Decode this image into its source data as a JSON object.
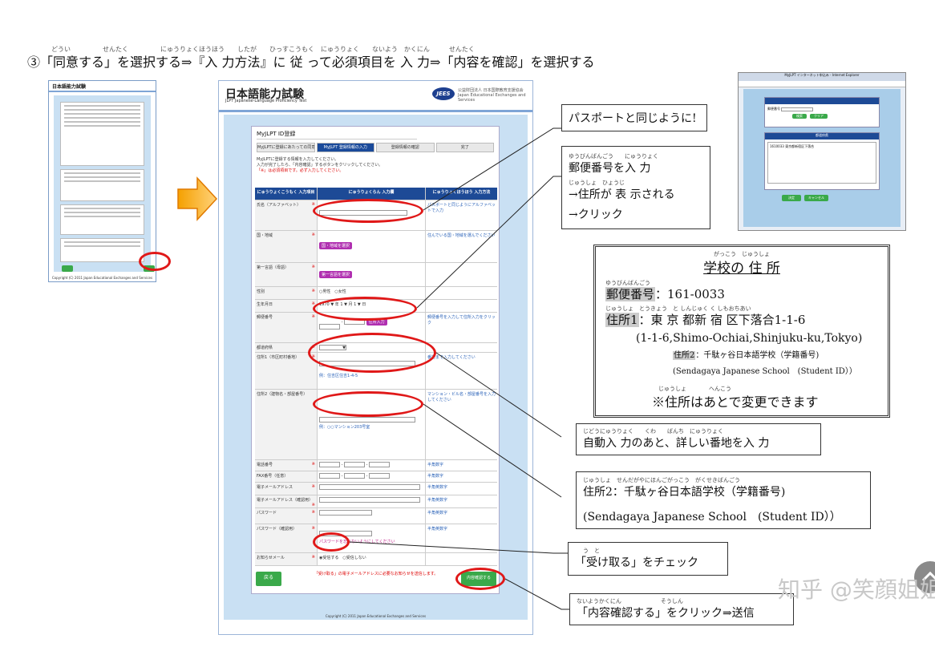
{
  "header": {
    "step_marker": "③",
    "instruction": "「同意する」を選択する⇒『入 力方法』に 従 って必須項目を 入 力⇒「内容を確認」を選択する",
    "ruby": "どうい　　　　　せんたく　　　　　にゅうりょくほうほう　　したが　　ひっすこうもく　にゅうりょく　　ないよう　かくにん　　　せんたく"
  },
  "thumbnail": {
    "logo": "日本語能力試験",
    "footer": "Copyright (C) 2011 Japan Educational Exchanges and Services"
  },
  "form_screenshot": {
    "logo": "日本語能力試験",
    "sublogo": "JLPT Japanese-Language Proficiency Test",
    "jees_badge": "JEES",
    "jees_org": "公益財団法人 日本国際教育支援協会 Japan Educational Exchanges and Services",
    "panel_title": "MyJLPT ID登録",
    "steps": [
      "MyJLPTに登録にあたっての同意事項",
      "MyJLPT 登録情報の入力",
      "登録情報の確認",
      "完了"
    ],
    "intro_line1": "MyJLPTに登録する情報を入力してください。",
    "intro_line2": "入力が完了したら、「内容確認」するボタンをクリックしてください。",
    "intro_required": "「※」は必須項目です。必ず入力してください。",
    "table_headers": [
      "にゅうりょくこうもく 入力項目",
      "にゅうりょくらん 入力欄",
      "にゅうりょくほうほう 入力方法"
    ],
    "rows": [
      {
        "label": "氏名（アルファベット）",
        "note": "パスポートと同じようにアルファベットで入力"
      },
      {
        "label": "国・地域",
        "button": "国・地域を選択",
        "note": "住んでいる国・地域を選んでください"
      },
      {
        "label": "第一言語（母語）",
        "button": "第一言語を選択",
        "note": ""
      },
      {
        "label": "性別",
        "options": "○男性　○女性",
        "note": ""
      },
      {
        "label": "生年月日",
        "value": "1970 ▼ 年 1 ▼ 月 1 ▼ 日",
        "note": ""
      },
      {
        "label": "郵便番号",
        "button": "住所入力",
        "note": "郵便番号を入力して住所入力をクリック"
      },
      {
        "label": "都道府県",
        "value": "▼",
        "note": ""
      },
      {
        "label": "住所1（市区町村番地）",
        "sample": "例：住吉区住吉1-4-5",
        "note": "番地まで入力してください"
      },
      {
        "label": "住所2（建物名・部屋番号）",
        "sample": "例：○○マンション203号室",
        "note": "マンション・ビル名・部屋番号を入力してください"
      },
      {
        "label": "電話番号",
        "note": "半角数字"
      },
      {
        "label": "FAX番号（任意）",
        "note": "半角数字"
      },
      {
        "label": "電子メールアドレス",
        "note": "半角英数字"
      },
      {
        "label": "電子メールアドレス（確認用）",
        "note": "半角英数字"
      },
      {
        "label": "パスワード",
        "note": "半角英数字"
      },
      {
        "label": "パスワード（確認用）",
        "warning": "パスワードを忘れないようにしてください",
        "note": "半角英数字"
      },
      {
        "label": "お知らせメール",
        "options": "◉受信する　○受信しない",
        "note": ""
      }
    ],
    "notice": "「受け取る」の電子メールアドレスに必要なお知らせを送信します。",
    "back_button": "戻る",
    "confirm_button": "内容確認する",
    "copyright": "Copyright (C) 2011 Japan Educational Exchanges and Services"
  },
  "callouts": {
    "passport": "パスポートと同じように!",
    "postal_line1": "郵便番号を入 力",
    "postal_line1_ruby": "ゆうびんばんごう　　にゅうりょく",
    "postal_line2": "→住所が 表 示される",
    "postal_line2_ruby": "じゅうしょ　ひょうじ",
    "postal_line3": "→クリック",
    "detail": "自動入 力のあと、詳しい番地を入 力",
    "detail_ruby": "じどうにゅうりょく　　くわ　　ばんち　にゅうりょく",
    "addr2_line1": "住所2：千駄ヶ谷日本語学校（学籍番号)",
    "addr2_ruby": "じゅうしょ　せんだがやにほんごがっこう　がくせきばんごう",
    "addr2_line2": "(Sendagaya Japanese School　(Student ID））",
    "receive": "「受け取る」をチェック",
    "receive_ruby": "う　と",
    "confirm": "「内容確認する」をクリック⇒送信",
    "confirm_ruby": "ないようかくにん　　　　　　　そうしん"
  },
  "ie_window": {
    "title": "MyJLPT インターネット申込み - Internet Explorer",
    "label1": "郵便番号",
    "label2": "都道府県",
    "button1": "検索",
    "button2": "クリア",
    "ok": "決定",
    "cancel": "キャンセル",
    "result": "1610033 東京都新宿区下落合"
  },
  "school_address": {
    "title": "学校の 住 所",
    "title_ruby": "がっこう　じゅうしょ",
    "postal_label": "郵便番号",
    "postal_ruby": "ゆうびんばんごう",
    "postal_value": "：161-0033",
    "addr1_label": "住所1",
    "addr1_ruby": "じゅうしょ　とうきょう　と しんじゅく く しもおちあい",
    "addr1_value": "：東 京 都新 宿 区下落合1-1-6",
    "addr1_roman": "(1-1-6,Shimo-Ochiai,Shinjuku-ku,Tokyo)",
    "addr2_label": "住所2",
    "addr2_value": "：千駄ヶ谷日本語学校（学籍番号)",
    "addr2_roman": "(Sendagaya Japanese School　(Student ID））",
    "note": "※住所はあとで変更できます",
    "note_ruby": "じゅうしょ　　　　へんこう"
  },
  "watermark": "知乎 @笑顔姐姐"
}
